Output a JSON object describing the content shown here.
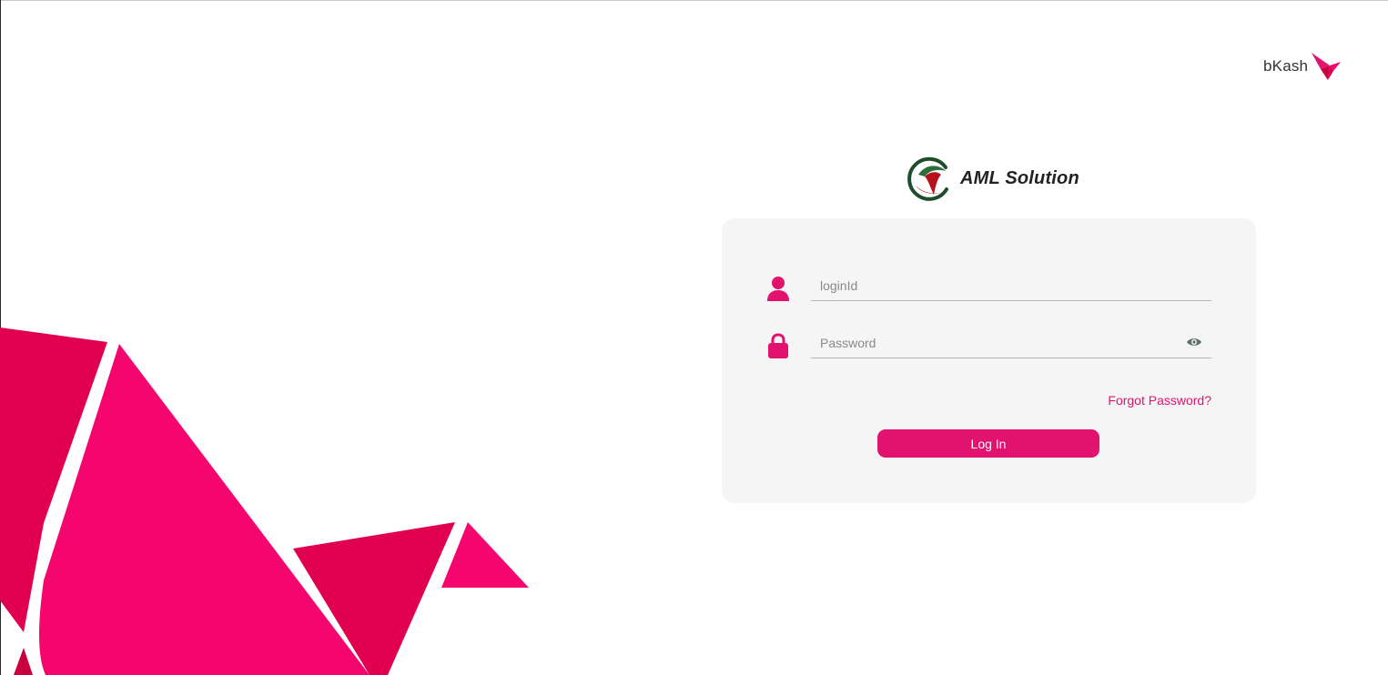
{
  "brand": {
    "name": "bKash",
    "icon": "bkash-bird-icon",
    "accent_color": "#e2136e"
  },
  "app": {
    "title": "AML Solution",
    "logo_icon": "aml-logo-icon"
  },
  "login_form": {
    "login_id": {
      "placeholder": "loginId",
      "value": "",
      "icon": "user-icon"
    },
    "password": {
      "placeholder": "Password",
      "value": "",
      "icon": "lock-icon",
      "toggle_icon": "eye-icon"
    },
    "forgot_password_label": "Forgot Password?",
    "login_button_label": "Log In"
  },
  "colors": {
    "primary_pink": "#e2136e",
    "origami_light": "#f5066e",
    "origami_dark": "#e1004f",
    "card_background": "#f5f5f5"
  }
}
